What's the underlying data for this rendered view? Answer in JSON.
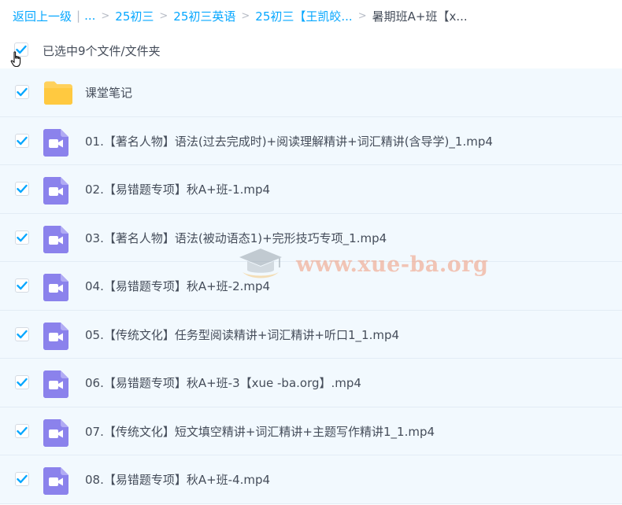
{
  "breadcrumb": {
    "back": "返回上一级",
    "ellipsis": "...",
    "items": [
      "25初三",
      "25初三英语",
      "25初三【王凯皎..."
    ],
    "current": "暑期班A+班【x..."
  },
  "selection": {
    "text": "已选中9个文件/文件夹",
    "checked": true
  },
  "files": [
    {
      "name": "课堂笔记",
      "type": "folder",
      "checked": true
    },
    {
      "name": "01.【著名人物】语法(过去完成时)+阅读理解精讲+词汇精讲(含导学)_1.mp4",
      "type": "video",
      "checked": true
    },
    {
      "name": "02.【易错题专项】秋A+班-1.mp4",
      "type": "video",
      "checked": true
    },
    {
      "name": "03.【著名人物】语法(被动语态1)+完形技巧专项_1.mp4",
      "type": "video",
      "checked": true
    },
    {
      "name": "04.【易错题专项】秋A+班-2.mp4",
      "type": "video",
      "checked": true
    },
    {
      "name": "05.【传统文化】任务型阅读精讲+词汇精讲+听口1_1.mp4",
      "type": "video",
      "checked": true
    },
    {
      "name": "06.【易错题专项】秋A+班-3【xue -ba.org】.mp4",
      "type": "video",
      "checked": true
    },
    {
      "name": "07.【传统文化】短文填空精讲+词汇精讲+主题写作精讲1_1.mp4",
      "type": "video",
      "checked": true
    },
    {
      "name": "08.【易错题专项】秋A+班-4.mp4",
      "type": "video",
      "checked": true
    }
  ],
  "watermark": "www.xue-ba.org",
  "colors": {
    "accent": "#06a7ff",
    "row_bg": "#f2f9fe",
    "video_icon": "#8b82ec",
    "folder_icon": "#ffd15c"
  },
  "icons": {
    "folder": "folder-icon",
    "video": "video-file-icon",
    "checkbox": "checkbox-checked-icon",
    "cursor": "hand-cursor-icon"
  }
}
